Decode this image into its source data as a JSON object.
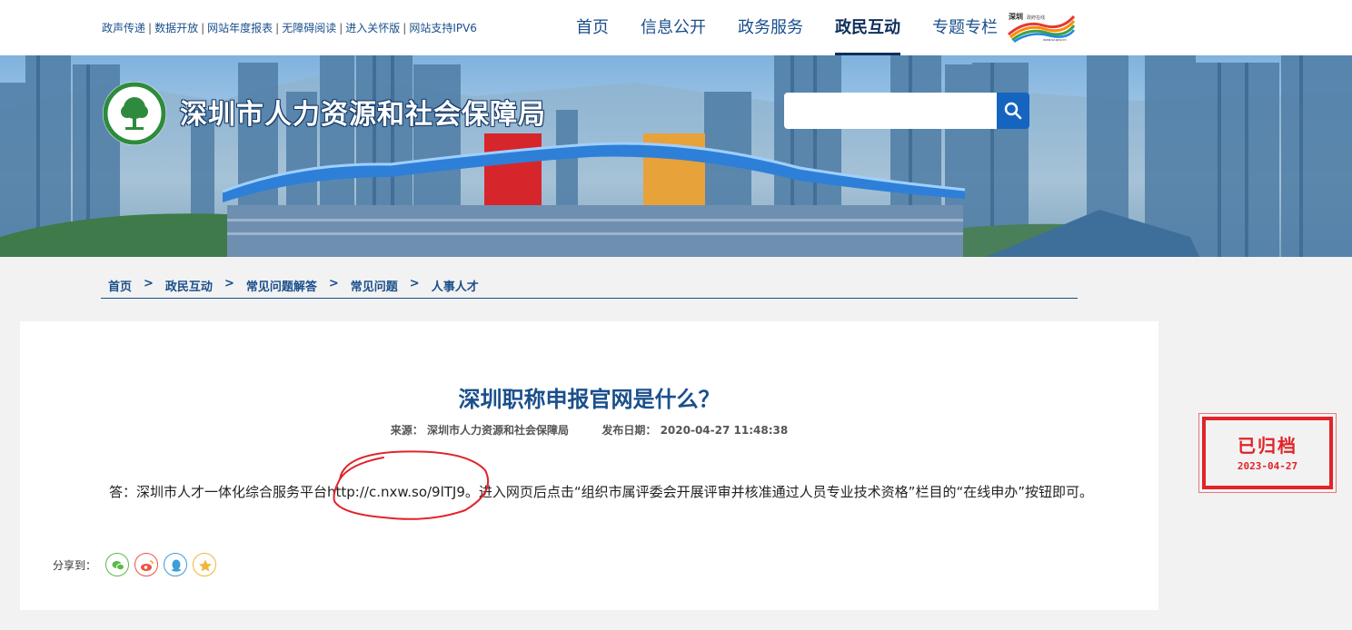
{
  "topbar": {
    "links": [
      "政声传递",
      "数据开放",
      "网站年度报表",
      "无障碍阅读",
      "进入关怀版",
      "网站支持IPV6"
    ],
    "nav": [
      "首页",
      "信息公开",
      "政务服务",
      "政民互动",
      "专题专栏"
    ],
    "active_nav": "政民互动",
    "logo": {
      "name": "shenzhen-china-logo",
      "lines": [
        "深圳 政府在线",
        "SHENZHEN CHINA",
        "www.sz.gov.cn"
      ]
    }
  },
  "banner": {
    "site_title": "深圳市人力资源和社会保障局",
    "emblem_icon": "tree-emblem-icon",
    "search": {
      "placeholder": "",
      "button_icon": "search-icon"
    }
  },
  "breadcrumb": [
    "首页",
    "政民互动",
    "常见问题解答",
    "常见问题",
    "人事人才"
  ],
  "article": {
    "title": "深圳职称申报官网是什么？",
    "source_label": "来源：",
    "source": "深圳市人力资源和社会保障局",
    "date_label": "发布日期：",
    "date": "2020-04-27 11:48:38",
    "body": "答：深圳市人才一体化综合服务平台http://c.nxw.so/9lTJ9。进入网页后点击“组织市属评委会开展评审并核准通过人员专业技术资格”栏目的“在线申办”按钮即可。"
  },
  "share": {
    "label": "分享到：",
    "icons": [
      "wechat-icon",
      "weibo-icon",
      "qq-icon",
      "favorite-icon"
    ]
  },
  "stamp": {
    "label": "已归档",
    "date": "2023-04-27"
  },
  "colors": {
    "primary": "#1a4f8b",
    "stamp_red": "#e0242a",
    "search_blue": "#1565c0"
  }
}
